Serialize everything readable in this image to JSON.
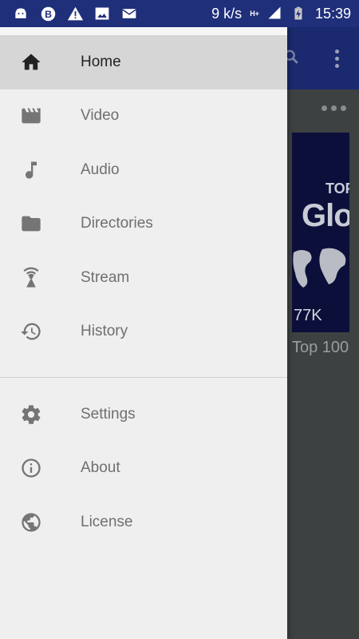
{
  "status_bar": {
    "left_icons": [
      "android-icon",
      "b-badge-icon",
      "warning-icon",
      "image-icon",
      "email-icon"
    ],
    "speed": "9 k/s",
    "network": "H+",
    "time": "15:39"
  },
  "background": {
    "thumbnail_title_1": "TOP",
    "thumbnail_title_2": "Glo",
    "thumbnail_views": "77K",
    "caption": "Top 100"
  },
  "drawer": {
    "primary_items": [
      {
        "label": "Home",
        "icon": "home-icon",
        "active": true
      },
      {
        "label": "Video",
        "icon": "video-icon",
        "active": false
      },
      {
        "label": "Audio",
        "icon": "music-note-icon",
        "active": false
      },
      {
        "label": "Directories",
        "icon": "folder-icon",
        "active": false
      },
      {
        "label": "Stream",
        "icon": "stream-icon",
        "active": false
      },
      {
        "label": "History",
        "icon": "history-icon",
        "active": false
      }
    ],
    "secondary_items": [
      {
        "label": "Settings",
        "icon": "gear-icon"
      },
      {
        "label": "About",
        "icon": "info-icon"
      },
      {
        "label": "License",
        "icon": "globe-icon"
      }
    ]
  },
  "colors": {
    "status_bar": "#1f2f7a",
    "toolbar": "#1b2a6e",
    "drawer_bg": "#efefef",
    "active_row": "#d6d6d6"
  }
}
